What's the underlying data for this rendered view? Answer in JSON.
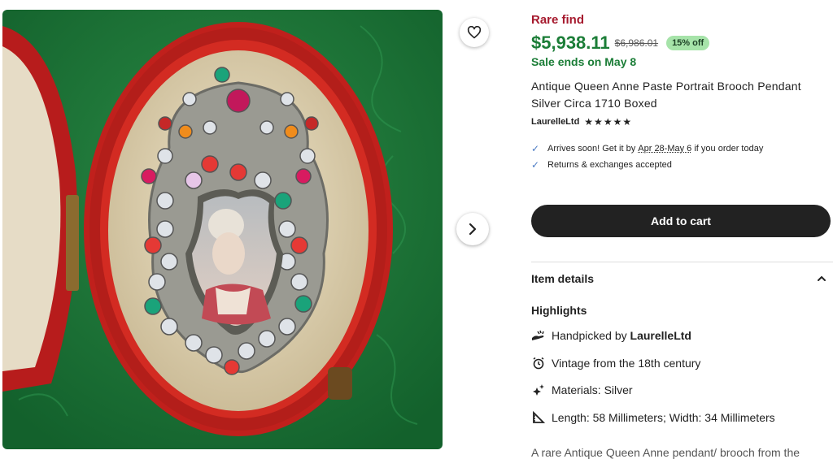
{
  "listing": {
    "image_alt": "Antique brooch pendant in red egg-shaped case",
    "rare_label": "Rare find",
    "price": "$5,938.11",
    "original_price": "$6,986.01",
    "discount": "15% off",
    "sale_ends": "Sale ends on May 8",
    "title": "Antique Queen Anne Paste Portrait Brooch Pendant Silver Circa 1710 Boxed",
    "shop_name": "LaurelleLtd",
    "rating_stars": "★★★★★",
    "rating": 5
  },
  "shipping": {
    "arrives_prefix": "Arrives soon! Get it by ",
    "arrives_dates": "Apr 28-May 6",
    "arrives_suffix": " if you order today",
    "returns": "Returns & exchanges accepted"
  },
  "actions": {
    "add_to_cart": "Add to cart"
  },
  "details": {
    "heading": "Item details",
    "highlights_heading": "Highlights",
    "handpicked_prefix": "Handpicked by ",
    "handpicked_shop": "LaurelleLtd",
    "vintage": "Vintage from the 18th century",
    "materials": "Materials: Silver",
    "dimensions": "Length: 58 Millimeters; Width: 34 Millimeters",
    "description_start": "A rare Antique Queen Anne pendant/ brooch from the"
  },
  "icons": {
    "favorite": "heart-icon",
    "next": "chevron-right-icon",
    "check": "check-icon",
    "collapse": "chevron-up-icon",
    "handpicked": "hand-icon",
    "vintage": "alarm-clock-icon",
    "materials": "sparkle-icon",
    "dimensions": "ruler-icon"
  },
  "colors": {
    "rare": "#a61a2e",
    "price": "#1b7d37",
    "badge_bg": "#a6e3a9",
    "cart_bg": "#222222",
    "check": "#4d7cc4",
    "photo_bg": "#1f7a3a"
  }
}
